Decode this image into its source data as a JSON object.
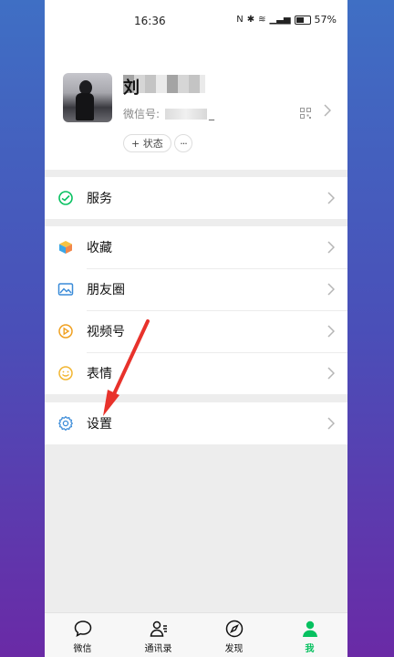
{
  "status_bar": {
    "time": "16:36",
    "battery": "57%"
  },
  "profile": {
    "name_visible": "刘",
    "wechat_id_label": "微信号:",
    "wechat_id_suffix": "_",
    "status_button": "+ 状态",
    "more_button": "···"
  },
  "menu": {
    "services": "服务",
    "favorites": "收藏",
    "moments": "朋友圈",
    "channels": "视频号",
    "stickers": "表情",
    "settings": "设置"
  },
  "tabs": [
    {
      "label": "微信"
    },
    {
      "label": "通讯录"
    },
    {
      "label": "发现"
    },
    {
      "label": "我"
    }
  ],
  "colors": {
    "accent": "#07c160",
    "annotation_arrow": "#e8322b"
  }
}
